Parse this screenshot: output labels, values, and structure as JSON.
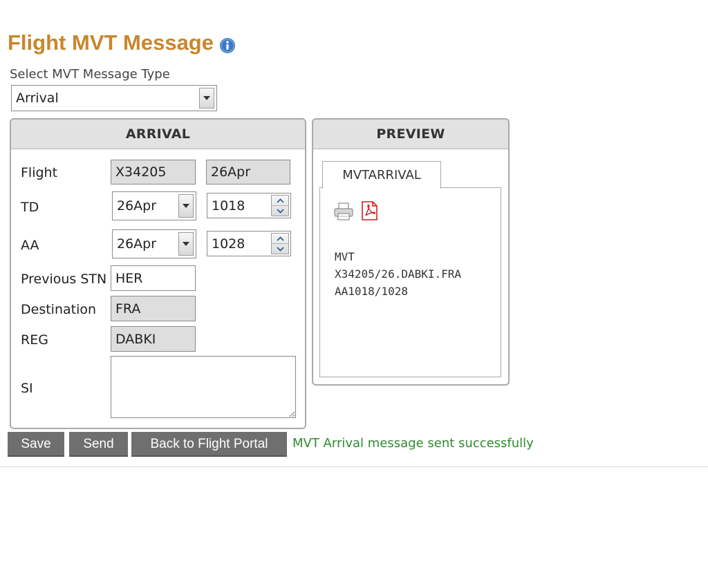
{
  "page": {
    "title": "Flight MVT Message"
  },
  "type_select": {
    "label": "Select MVT Message Type",
    "value": "Arrival"
  },
  "arrival_panel": {
    "header": "ARRIVAL",
    "flight": {
      "label": "Flight",
      "number": "X34205",
      "date": "26Apr"
    },
    "td": {
      "label": "TD",
      "date": "26Apr",
      "time": "1018"
    },
    "aa": {
      "label": "AA",
      "date": "26Apr",
      "time": "1028"
    },
    "previous_stn": {
      "label": "Previous STN",
      "value": "HER"
    },
    "destination": {
      "label": "Destination",
      "value": "FRA"
    },
    "reg": {
      "label": "REG",
      "value": "DABKI"
    },
    "si": {
      "label": "SI",
      "value": ""
    }
  },
  "preview_panel": {
    "header": "PREVIEW",
    "tab_label": "MVTARRIVAL",
    "message_lines": [
      "MVT",
      "X34205/26.DABKI.FRA",
      "AA1018/1028"
    ]
  },
  "actions": {
    "save_label": "Save",
    "send_label": "Send",
    "back_label": "Back to Flight Portal"
  },
  "status_message": "MVT Arrival message sent successfully",
  "colors": {
    "title": "#c8862c",
    "panel_header_bg": "#e2e2e2",
    "readonly_bg": "#dedede",
    "button_bg": "#6f6f6f",
    "success_text": "#2e8b2e",
    "info_icon": "#3a78c4",
    "pdf_icon": "#cc1f1f"
  },
  "icons": {
    "info": "info-icon",
    "print": "printer-icon",
    "pdf": "pdf-icon"
  }
}
